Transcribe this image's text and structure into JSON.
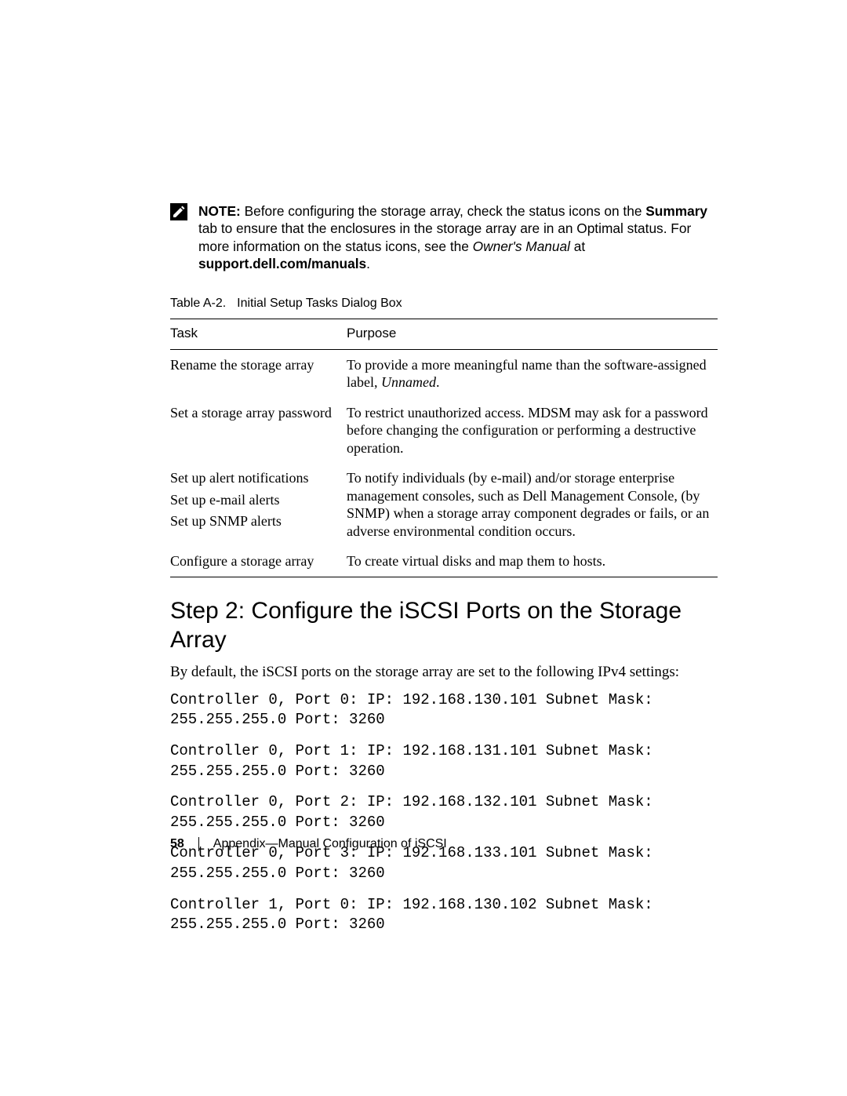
{
  "note": {
    "prefix": "NOTE:",
    "part1": " Before configuring the storage array, check the status icons on the ",
    "bold1": "Summary",
    "part2": " tab to ensure that the enclosures in the storage array are in an Optimal status. For more information on the status icons, see the ",
    "italic1": "Owner's Manual",
    "part3": " at ",
    "bold2": "support.dell.com/manuals",
    "part4": "."
  },
  "table": {
    "caption_num": "Table A-2.",
    "caption_title": "Initial Setup Tasks Dialog Box",
    "headers": {
      "task": "Task",
      "purpose": "Purpose"
    },
    "rows": [
      {
        "task": "Rename the storage array",
        "purpose_pre": "To provide a more meaningful name than the software-assigned label, ",
        "purpose_italic": "Unnamed",
        "purpose_post": "."
      },
      {
        "task": "Set a storage array password",
        "purpose": "To restrict unauthorized access. MDSM may ask for a password before changing the configuration or performing a destructive operation."
      },
      {
        "tasks": [
          "Set up alert notifications",
          "Set up e-mail alerts",
          "Set up SNMP alerts"
        ],
        "purpose": "To notify individuals (by e-mail) and/or storage enterprise management consoles, such as Dell Management Console, (by SNMP) when a storage array component degrades or fails, or an adverse environmental condition occurs."
      },
      {
        "task": "Configure a storage array",
        "purpose": "To create virtual disks and map them to hosts."
      }
    ]
  },
  "heading": "Step 2: Configure the iSCSI Ports on the Storage Array",
  "body_intro": "By default, the iSCSI ports on the storage array are set to the following IPv4 settings:",
  "code_lines": [
    "Controller 0, Port 0: IP: 192.168.130.101 Subnet Mask: 255.255.255.0 Port: 3260",
    "Controller 0, Port 1: IP: 192.168.131.101 Subnet Mask: 255.255.255.0 Port: 3260",
    "Controller 0, Port 2: IP: 192.168.132.101 Subnet Mask: 255.255.255.0 Port: 3260",
    "Controller 0, Port 3: IP: 192.168.133.101 Subnet Mask: 255.255.255.0 Port: 3260",
    "Controller 1, Port 0: IP: 192.168.130.102 Subnet Mask: 255.255.255.0 Port: 3260"
  ],
  "footer": {
    "page_number": "58",
    "section": "Appendix—Manual Configuration of iSCSI"
  }
}
